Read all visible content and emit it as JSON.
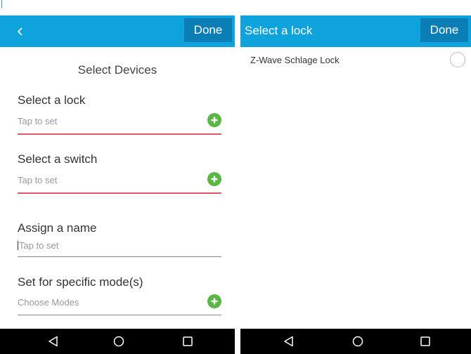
{
  "left": {
    "header": {
      "done_label": "Done"
    },
    "page_title": "Select Devices",
    "fields": [
      {
        "label": "Select a lock",
        "value": "Tap to set"
      },
      {
        "label": "Select a switch",
        "value": "Tap to set"
      },
      {
        "label": "Assign a name",
        "value": "Tap to set"
      },
      {
        "label": "Set for specific mode(s)",
        "value": "Choose Modes"
      }
    ]
  },
  "right": {
    "header": {
      "title": "Select a lock",
      "done_label": "Done"
    },
    "items": [
      {
        "label": "Z-Wave Schlage Lock"
      }
    ]
  },
  "colors": {
    "header_blue": "#0fa3dd",
    "done_button": "#0b7fb5",
    "add_green": "#5cb646",
    "error_underline": "#e05a64"
  },
  "icons": {
    "back": "chevron-left-icon",
    "add": "plus-circle-icon",
    "nav_back": "triangle-back-icon",
    "nav_home": "circle-home-icon",
    "nav_recents": "square-recents-icon"
  }
}
